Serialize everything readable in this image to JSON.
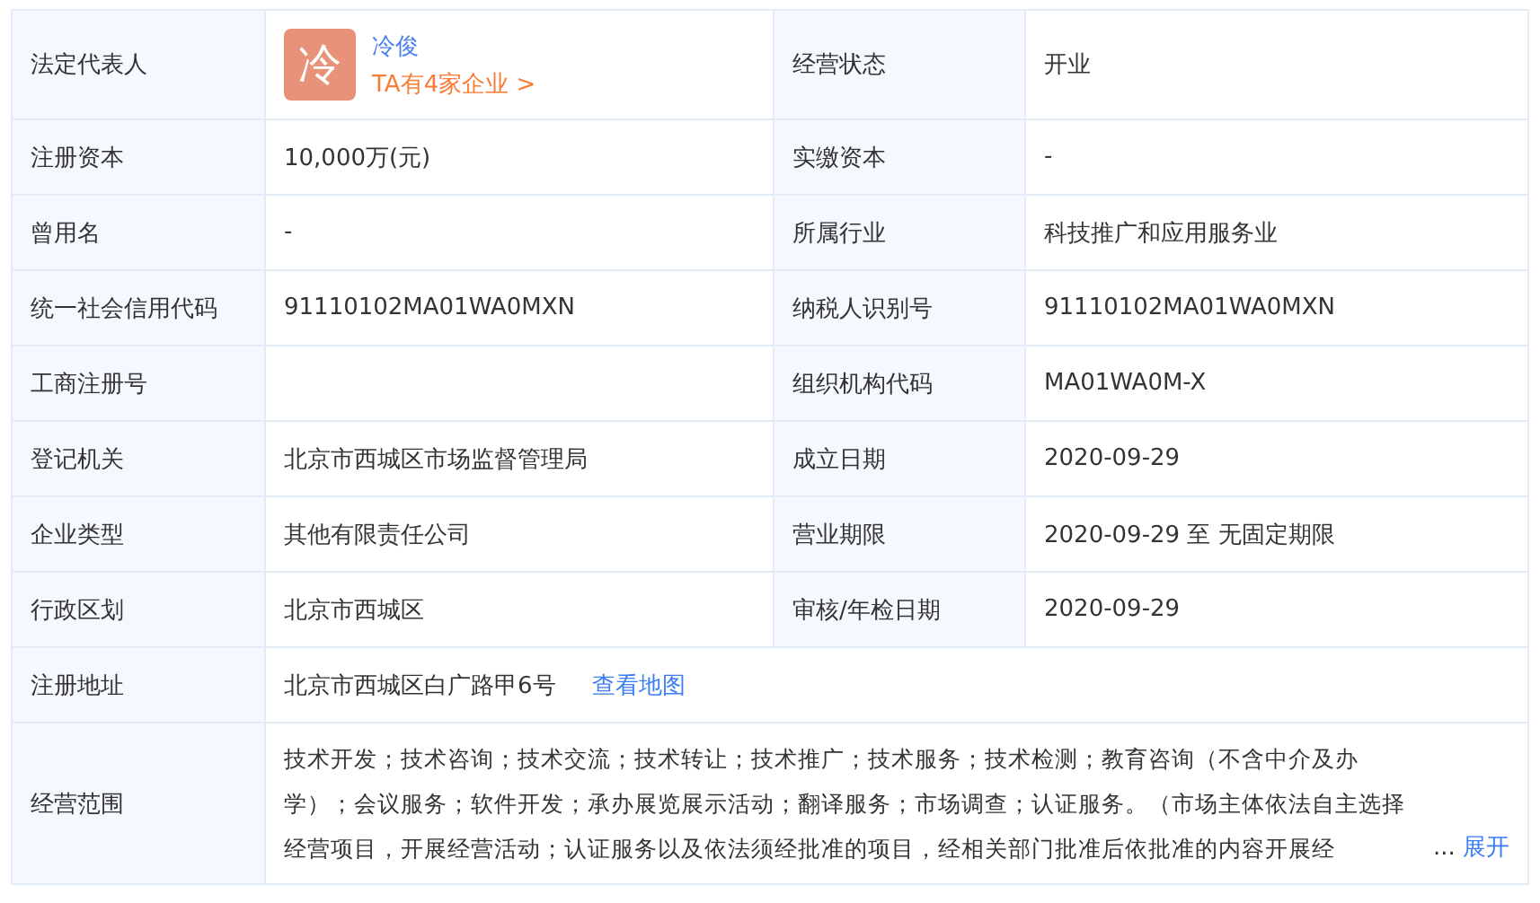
{
  "legal_rep": {
    "label": "法定代表人",
    "avatar_char": "冷",
    "name": "冷俊",
    "companies_link": "TA有4家企业 >"
  },
  "status": {
    "label": "经营状态",
    "value": "开业"
  },
  "rows": [
    {
      "label": "注册资本",
      "value": "10,000万(元)",
      "label2": "实缴资本",
      "value2": "-"
    },
    {
      "label": "曾用名",
      "value": "-",
      "label2": "所属行业",
      "value2": "科技推广和应用服务业"
    },
    {
      "label": "统一社会信用代码",
      "value": "91110102MA01WA0MXN",
      "label2": "纳税人识别号",
      "value2": "91110102MA01WA0MXN"
    },
    {
      "label": "工商注册号",
      "label2": "组织机构代码",
      "value2": "MA01WA0M-X"
    },
    {
      "label": "登记机关",
      "value": "北京市西城区市场监督管理局",
      "label2": "成立日期",
      "value2": "2020-09-29"
    },
    {
      "label": "企业类型",
      "value": "其他有限责任公司",
      "label2": "营业期限",
      "value2": "2020-09-29 至 无固定期限"
    },
    {
      "label": "行政区划",
      "value": "北京市西城区",
      "label2": "审核/年检日期",
      "value2": "2020-09-29"
    }
  ],
  "address": {
    "label": "注册地址",
    "value": "北京市西城区白广路甲6号",
    "map_link": "查看地图"
  },
  "scope": {
    "label": "经营范围",
    "text": "技术开发；技术咨询；技术交流；技术转让；技术推广；技术服务；技术检测；教育咨询（不含中介及办学）；会议服务；软件开发；承办展览展示活动；翻译服务；市场调查；认证服务。（市场主体依法自主选择经营项目，开展经营活动；认证服务以及依法须经批准的项目，经相关部门批准后依批准的内容开展经",
    "ellipsis": "...",
    "expand_link": "展开"
  }
}
